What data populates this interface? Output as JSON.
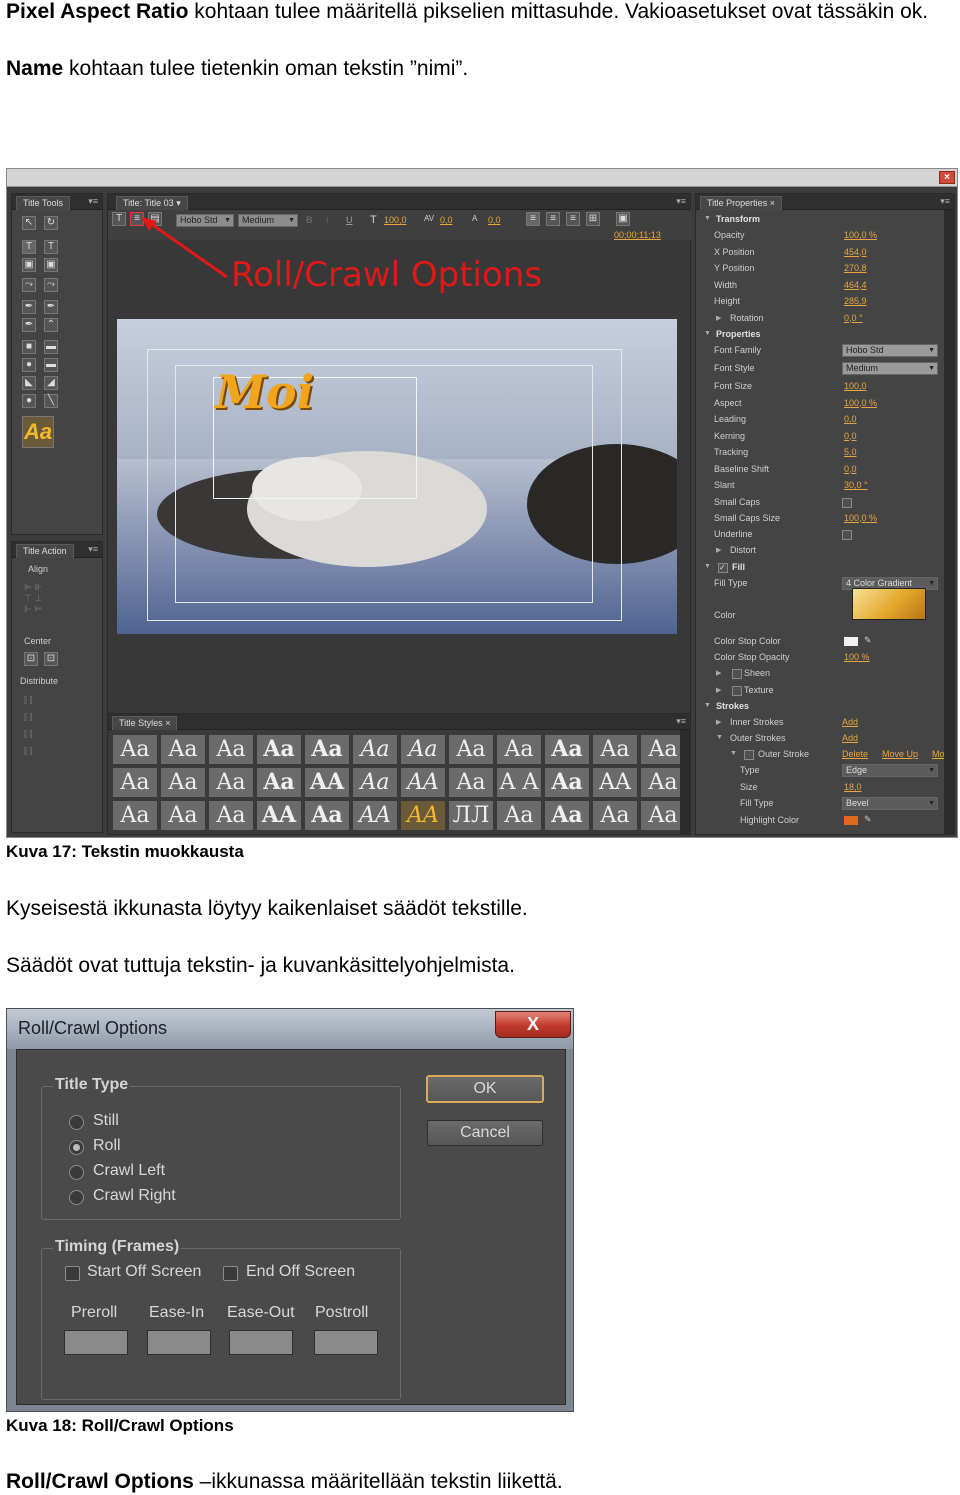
{
  "intro": {
    "line1_bold": "Pixel Aspect Ratio",
    "line1_rest": " kohtaan tulee määritellä pikselien mittasuhde. Vakioasetukset ovat tässäkin ok.",
    "line2_bold": "Name",
    "line2_rest": " kohtaan tulee tietenkin oman tekstin ”nimi”."
  },
  "figure17": {
    "caption": "Kuva 17: Tekstin muokkausta",
    "annotation": "Roll/Crawl Options",
    "title_tools_tab": "Title Tools",
    "title_tab": "Title: Title 03",
    "title_action_tab": "Title Action",
    "align_label": "Align",
    "center_label": "Center",
    "distribute_label": "Distribute",
    "toolbar": {
      "font_family": "Hobo Std",
      "font_style": "Medium",
      "font_size": "100,0",
      "kerning": "0,0",
      "leading": "0,0",
      "timecode": "00;00;11;13"
    },
    "canvas_text": "Moi",
    "title_styles_tab": "Title Styles",
    "style_samples": [
      "Aa",
      "Aa",
      "Aa",
      "Aa",
      "Aa",
      "Aa",
      "Aa",
      "Aa",
      "Aa",
      "Aa",
      "Aa",
      "Aa",
      "Aa",
      "Aa",
      "Aa",
      "Aa",
      "AA",
      "Aa",
      "AA",
      "Aa",
      "A A",
      "Aa",
      "AA",
      "Aa",
      "Aa",
      "Aa",
      "Aa",
      "AA",
      "Aa",
      "AA",
      "AA",
      "ЛЛ",
      "Aa",
      "Aa",
      "Aa",
      "Aa"
    ],
    "properties_tab": "Title Properties",
    "properties": [
      {
        "type": "section",
        "label": "Transform"
      },
      {
        "type": "row",
        "label": "Opacity",
        "value": "100,0 %"
      },
      {
        "type": "row",
        "label": "X Position",
        "value": "454,0"
      },
      {
        "type": "row",
        "label": "Y Position",
        "value": "270,8"
      },
      {
        "type": "row",
        "label": "Width",
        "value": "464,4"
      },
      {
        "type": "row",
        "label": "Height",
        "value": "285,9"
      },
      {
        "type": "sub",
        "label": "Rotation",
        "value": "0,0 °"
      },
      {
        "type": "section",
        "label": "Properties"
      },
      {
        "type": "dropdown",
        "label": "Font Family",
        "value": "Hobo Std"
      },
      {
        "type": "dropdown",
        "label": "Font Style",
        "value": "Medium"
      },
      {
        "type": "row",
        "label": "Font Size",
        "value": "100,0"
      },
      {
        "type": "row",
        "label": "Aspect",
        "value": "100,0 %"
      },
      {
        "type": "row",
        "label": "Leading",
        "value": "0,0"
      },
      {
        "type": "row",
        "label": "Kerning",
        "value": "0,0"
      },
      {
        "type": "row",
        "label": "Tracking",
        "value": "5,0"
      },
      {
        "type": "row",
        "label": "Baseline Shift",
        "value": "0,0"
      },
      {
        "type": "row",
        "label": "Slant",
        "value": "30,0 °"
      },
      {
        "type": "check",
        "label": "Small Caps"
      },
      {
        "type": "row",
        "label": "Small Caps Size",
        "value": "100,0 %"
      },
      {
        "type": "check",
        "label": "Underline"
      },
      {
        "type": "sub",
        "label": "Distort"
      },
      {
        "type": "section",
        "label": "Fill"
      },
      {
        "type": "dropdown",
        "label": "Fill Type",
        "value": "4 Color Gradient"
      },
      {
        "type": "gradient",
        "label": "Color"
      },
      {
        "type": "swatch",
        "label": "Color Stop Color"
      },
      {
        "type": "row",
        "label": "Color Stop Opacity",
        "value": "100 %"
      },
      {
        "type": "sub",
        "label": "Sheen"
      },
      {
        "type": "sub",
        "label": "Texture"
      },
      {
        "type": "section",
        "label": "Strokes"
      },
      {
        "type": "link",
        "label": "Inner Strokes",
        "value": "Add"
      },
      {
        "type": "link",
        "label": "Outer Strokes",
        "value": "Add"
      },
      {
        "type": "links",
        "label": "Outer Stroke",
        "values": [
          "Delete",
          "Move Up",
          "Mo"
        ]
      },
      {
        "type": "dropdown2",
        "label": "Type",
        "value": "Edge"
      },
      {
        "type": "row2",
        "label": "Size",
        "value": "18,0"
      },
      {
        "type": "dropdown2",
        "label": "Fill Type",
        "value": "Bevel"
      },
      {
        "type": "swatch2",
        "label": "Highlight Color"
      }
    ]
  },
  "body1": "Kyseisestä ikkunasta löytyy kaikenlaiset säädöt tekstille.",
  "body2": "Säädöt ovat tuttuja tekstin- ja kuvankäsittelyohjelmista.",
  "dialog": {
    "title": "Roll/Crawl Options",
    "close": "X",
    "title_type_label": "Title Type",
    "title_type_options": [
      "Still",
      "Roll",
      "Crawl Left",
      "Crawl Right"
    ],
    "selected": "Roll",
    "ok": "OK",
    "cancel": "Cancel",
    "timing_label": "Timing (Frames)",
    "start_off_screen": "Start Off Screen",
    "end_off_screen": "End Off Screen",
    "preroll": "Preroll",
    "ease_in": "Ease-In",
    "ease_out": "Ease-Out",
    "postroll": "Postroll"
  },
  "figure18_caption": "Kuva 18: Roll/Crawl Options",
  "outro_bold": "Roll/Crawl Options",
  "outro_rest": " –ikkunassa määritellään tekstin liikettä."
}
